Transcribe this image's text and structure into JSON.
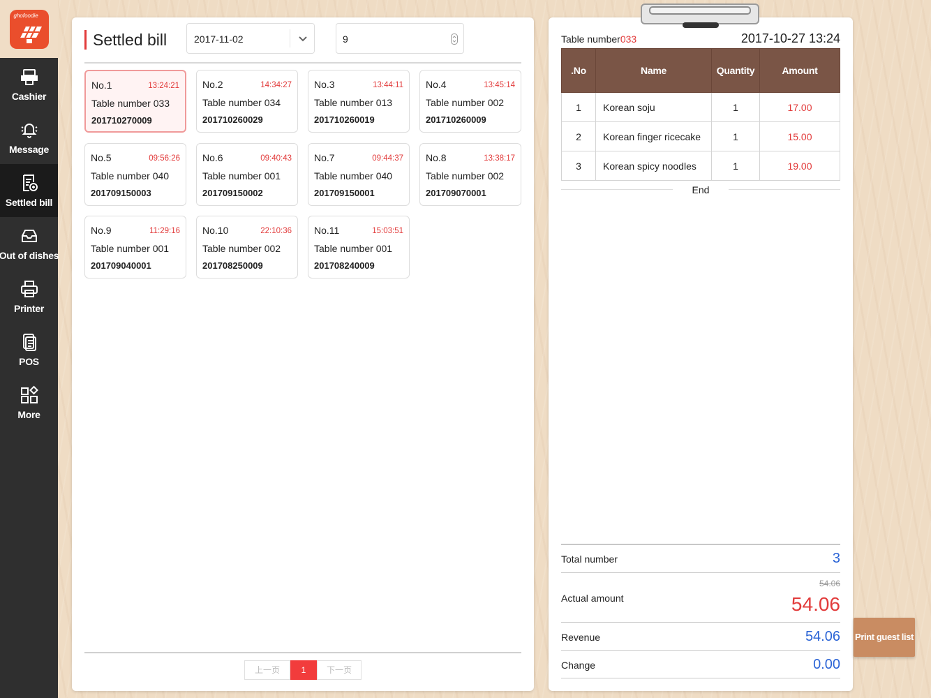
{
  "app": {
    "logo_text": "ghofoodie"
  },
  "sidebar": {
    "items": [
      {
        "label": "Cashier",
        "icon": "cashier-icon"
      },
      {
        "label": "Message",
        "icon": "bell-icon"
      },
      {
        "label": "Settled bill",
        "icon": "bill-icon"
      },
      {
        "label": "Out of dishes",
        "icon": "tray-icon"
      },
      {
        "label": "Printer",
        "icon": "printer-icon"
      },
      {
        "label": "POS",
        "icon": "pos-icon"
      },
      {
        "label": "More",
        "icon": "more-icon"
      }
    ],
    "active": "Settled bill"
  },
  "left": {
    "title": "Settled bill",
    "date_value": "2017-11-02",
    "number_value": "9",
    "bills": [
      {
        "no": "No.1",
        "time": "13:24:21",
        "table": "Table number 033",
        "id": "201710270009"
      },
      {
        "no": "No.2",
        "time": "14:34:27",
        "table": "Table number 034",
        "id": "201710260029"
      },
      {
        "no": "No.3",
        "time": "13:44:11",
        "table": "Table number 013",
        "id": "201710260019"
      },
      {
        "no": "No.4",
        "time": "13:45:14",
        "table": "Table number 002",
        "id": "201710260009"
      },
      {
        "no": "No.5",
        "time": "09:56:26",
        "table": "Table number 040",
        "id": "201709150003"
      },
      {
        "no": "No.6",
        "time": "09:40:43",
        "table": "Table number 001",
        "id": "201709150002"
      },
      {
        "no": "No.7",
        "time": "09:44:37",
        "table": "Table number 040",
        "id": "201709150001"
      },
      {
        "no": "No.8",
        "time": "13:38:17",
        "table": "Table number 002",
        "id": "201709070001"
      },
      {
        "no": "No.9",
        "time": "11:29:16",
        "table": "Table number 001",
        "id": "201709040001"
      },
      {
        "no": "No.10",
        "time": "22:10:36",
        "table": "Table number 002",
        "id": "201708250009"
      },
      {
        "no": "No.11",
        "time": "15:03:51",
        "table": "Table number 001",
        "id": "201708240009"
      }
    ],
    "pager": {
      "prev": "上一页",
      "current": "1",
      "next": "下一页"
    }
  },
  "right": {
    "table_label": "Table number",
    "table_number": "033",
    "datetime": "2017-10-27 13:24",
    "columns": {
      "no": ".No",
      "name": "Name",
      "qty": "Quantity",
      "amount": "Amount"
    },
    "items": [
      {
        "no": "1",
        "name": "Korean soju",
        "qty": "1",
        "amount": "17.00"
      },
      {
        "no": "2",
        "name": "Korean finger ricecake",
        "qty": "1",
        "amount": "15.00"
      },
      {
        "no": "3",
        "name": "Korean spicy noodles",
        "qty": "1",
        "amount": "19.00"
      }
    ],
    "end_text": "End",
    "total_label": "Total number",
    "total_value": "3",
    "actual_label": "Actual amount",
    "actual_original": "54.06",
    "actual_value": "54.06",
    "revenue_label": "Revenue",
    "revenue_value": "54.06",
    "change_label": "Change",
    "change_value": "0.00"
  },
  "print_button": "Print guest list",
  "colors": {
    "accent_red": "#e23b3b",
    "header_brown": "#7a5546",
    "blue_value": "#2b64d6",
    "sidebar_bg": "#2f2f2f"
  }
}
